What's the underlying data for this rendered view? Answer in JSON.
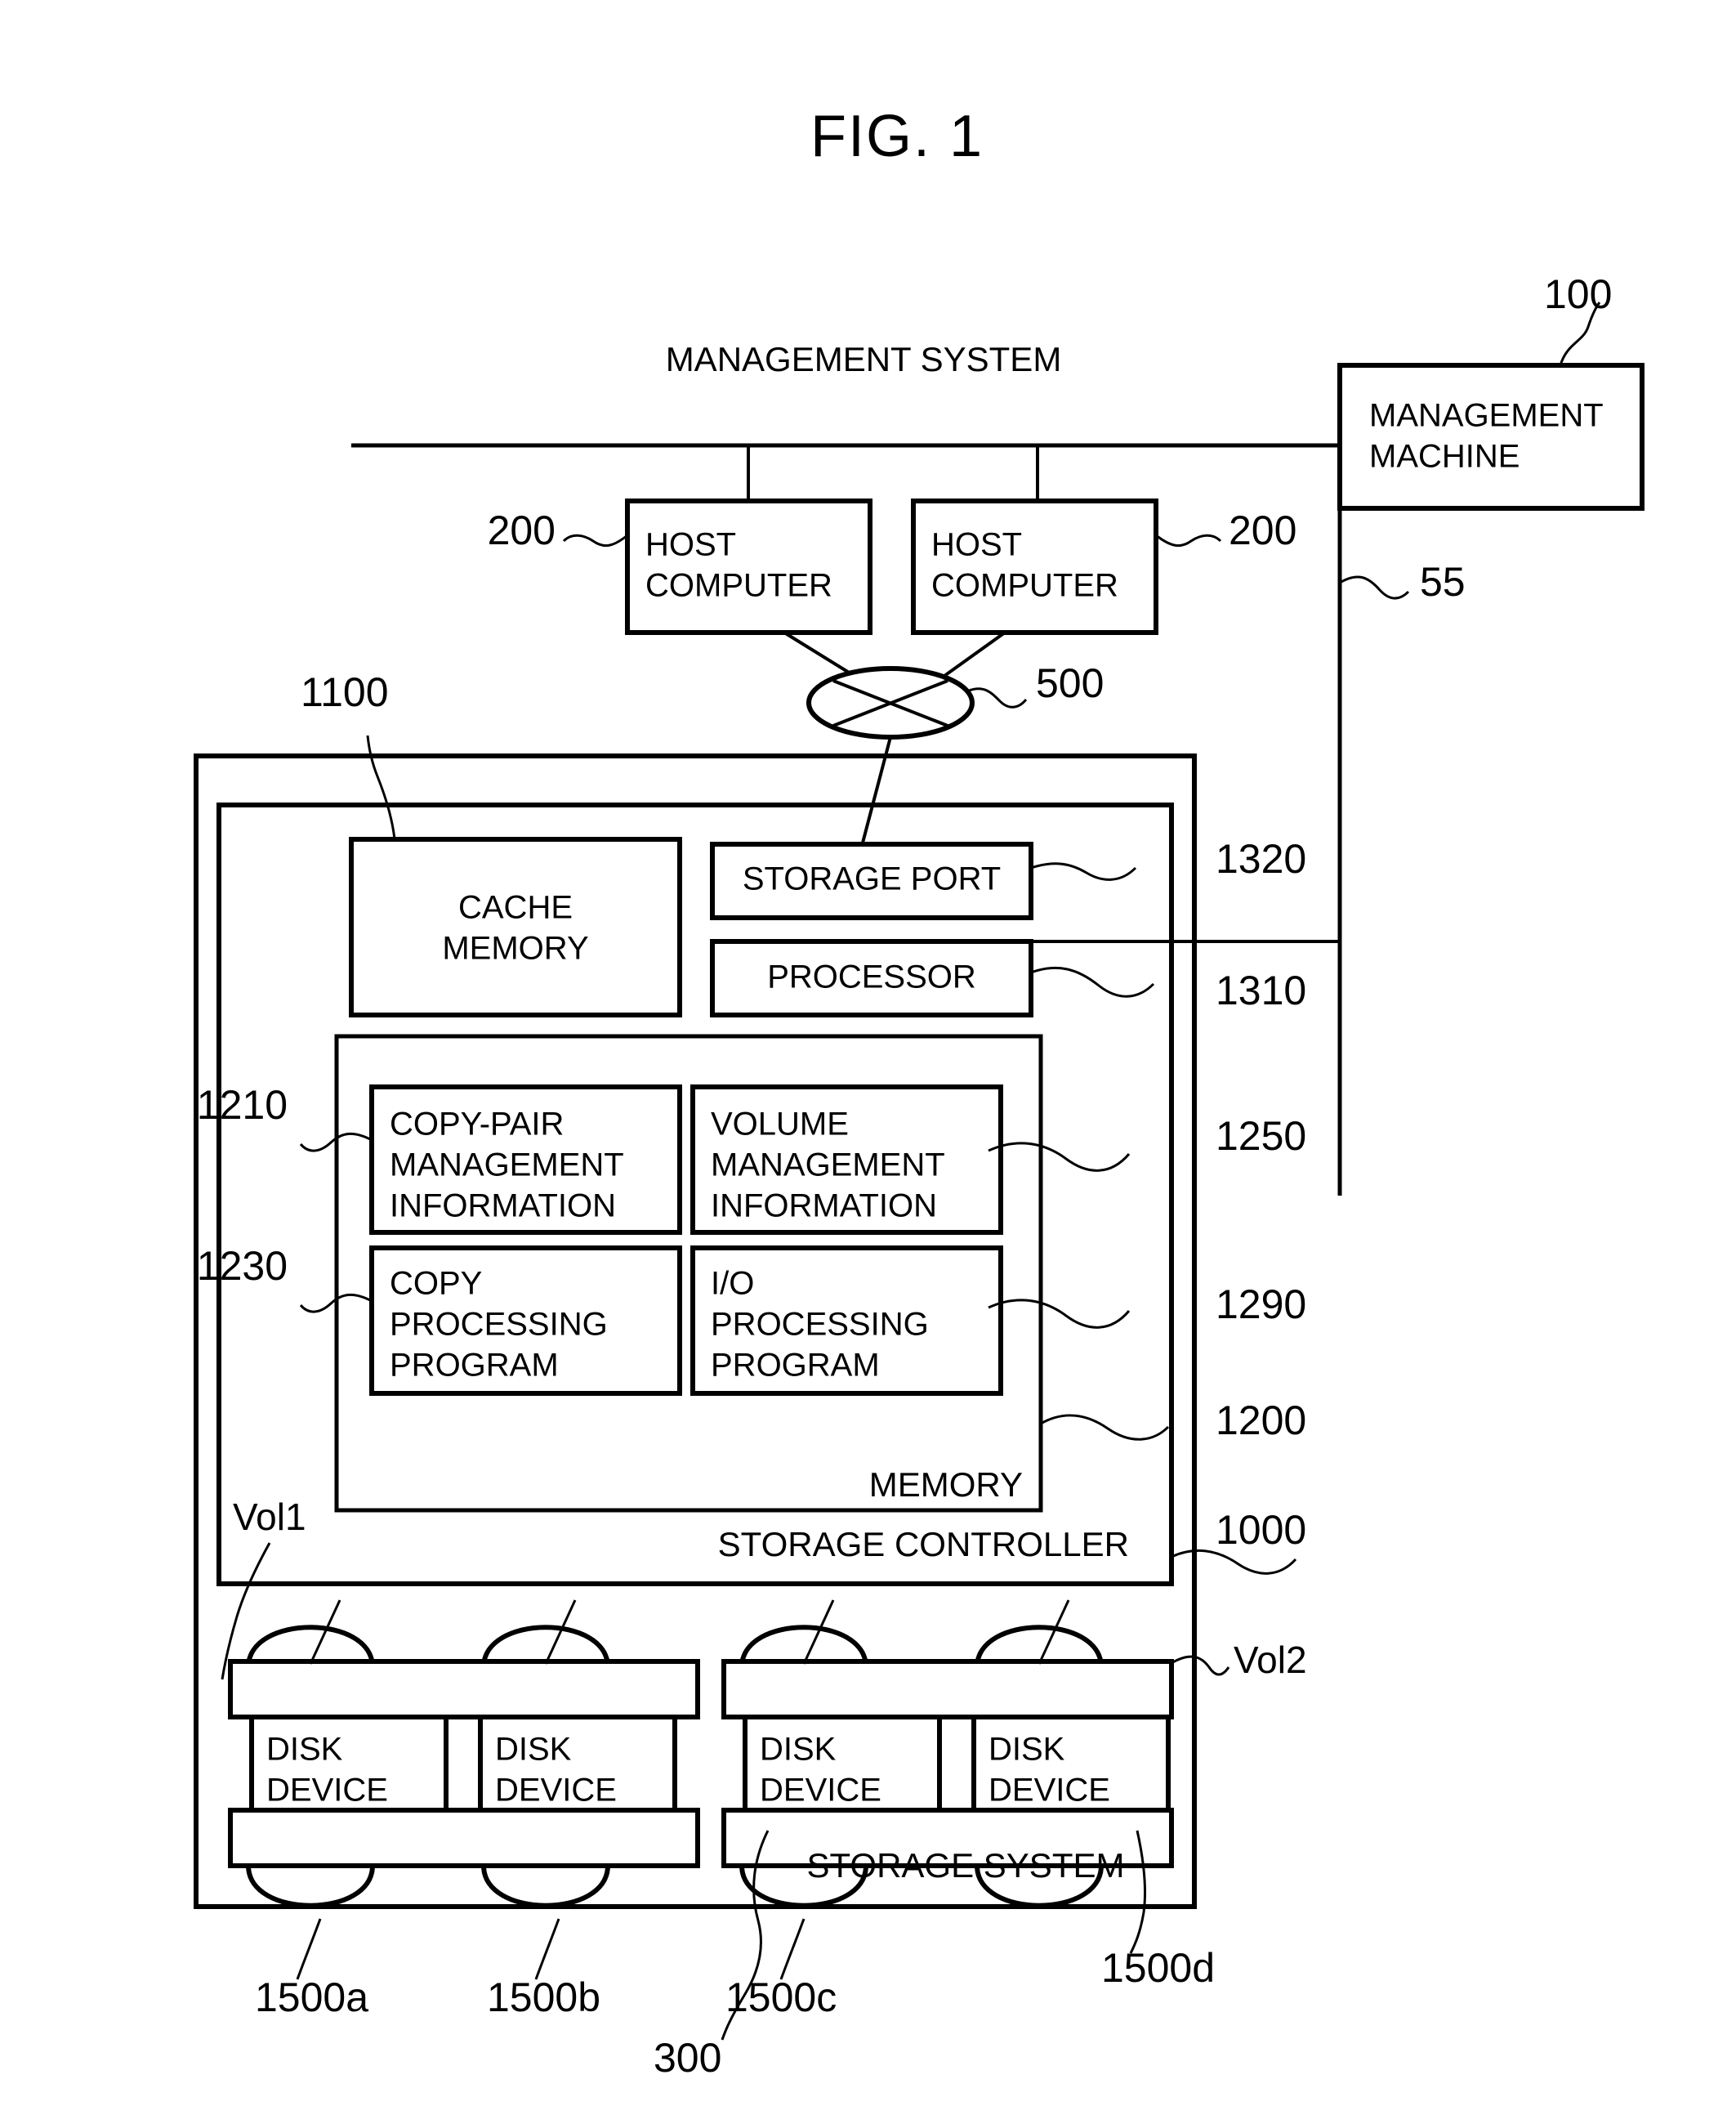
{
  "figure": {
    "title": "FIG. 1"
  },
  "labels": {
    "management_system": "MANAGEMENT SYSTEM",
    "management_machine_line1": "MANAGEMENT",
    "management_machine_line2": "MACHINE",
    "host_computer_line1": "HOST",
    "host_computer_line2": "COMPUTER",
    "cache_memory_line1": "CACHE",
    "cache_memory_line2": "MEMORY",
    "storage_port": "STORAGE PORT",
    "processor": "PROCESSOR",
    "copy_pair_mgmt_info_line1": "COPY-PAIR",
    "copy_pair_mgmt_info_line2": "MANAGEMENT",
    "copy_pair_mgmt_info_line3": "INFORMATION",
    "volume_mgmt_info_line1": "VOLUME",
    "volume_mgmt_info_line2": "MANAGEMENT",
    "volume_mgmt_info_line3": "INFORMATION",
    "copy_processing_program_line1": "COPY",
    "copy_processing_program_line2": "PROCESSING",
    "copy_processing_program_line3": "PROGRAM",
    "io_processing_program_line1": "I/O",
    "io_processing_program_line2": "PROCESSING",
    "io_processing_program_line3": "PROGRAM",
    "memory": "MEMORY",
    "storage_controller": "STORAGE CONTROLLER",
    "disk_device_line1": "DISK",
    "disk_device_line2": "DEVICE",
    "storage_system": "STORAGE SYSTEM",
    "vol1": "Vol1",
    "vol2": "Vol2"
  },
  "reference_numerals": {
    "management_machine": "100",
    "host_computer_left": "200",
    "host_computer_right": "200",
    "management_network": "55",
    "switch": "500",
    "cache_memory": "1100",
    "storage_port": "1320",
    "processor": "1310",
    "copy_pair_mgmt_info": "1210",
    "volume_mgmt_info": "1250",
    "copy_processing_program": "1230",
    "io_processing_program": "1290",
    "memory": "1200",
    "storage_controller": "1000",
    "disk_device_a": "1500a",
    "disk_device_b": "1500b",
    "disk_device_c": "1500c",
    "disk_device_d": "1500d",
    "storage_system": "300"
  },
  "colors": {
    "line": "#000000",
    "fill": "#ffffff"
  }
}
